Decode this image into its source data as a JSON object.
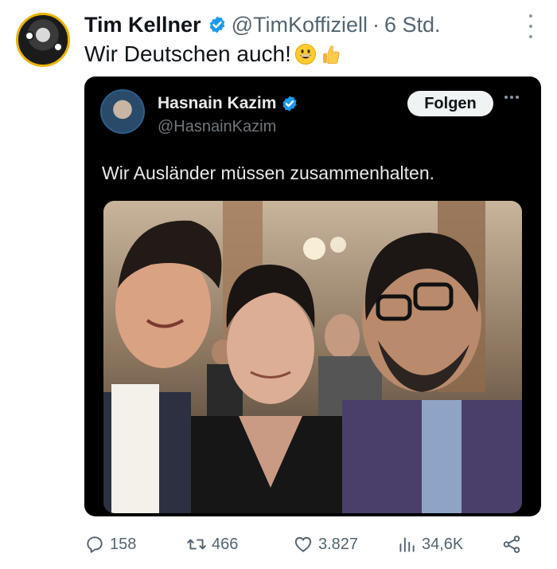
{
  "author": {
    "name": "Tim Kellner",
    "handle": "@TimKoffiziell",
    "separator": "·",
    "time": "6 Std.",
    "verified_icon": "verified-badge-icon"
  },
  "tweet": {
    "text": "Wir Deutschen auch!",
    "emojis": [
      "grinning-face-emoji",
      "thumbs-up-emoji"
    ]
  },
  "quoted": {
    "name": "Hasnain Kazim",
    "handle": "@HasnainKazim",
    "follow_label": "Folgen",
    "text": "Wir Ausländer müssen zusammenhalten."
  },
  "actions": {
    "replies": "158",
    "reposts": "466",
    "likes": "3.827",
    "views": "34,6K"
  },
  "colors": {
    "verified": "#1d9bf0",
    "muted": "#536471",
    "quote_bg": "#000000"
  }
}
